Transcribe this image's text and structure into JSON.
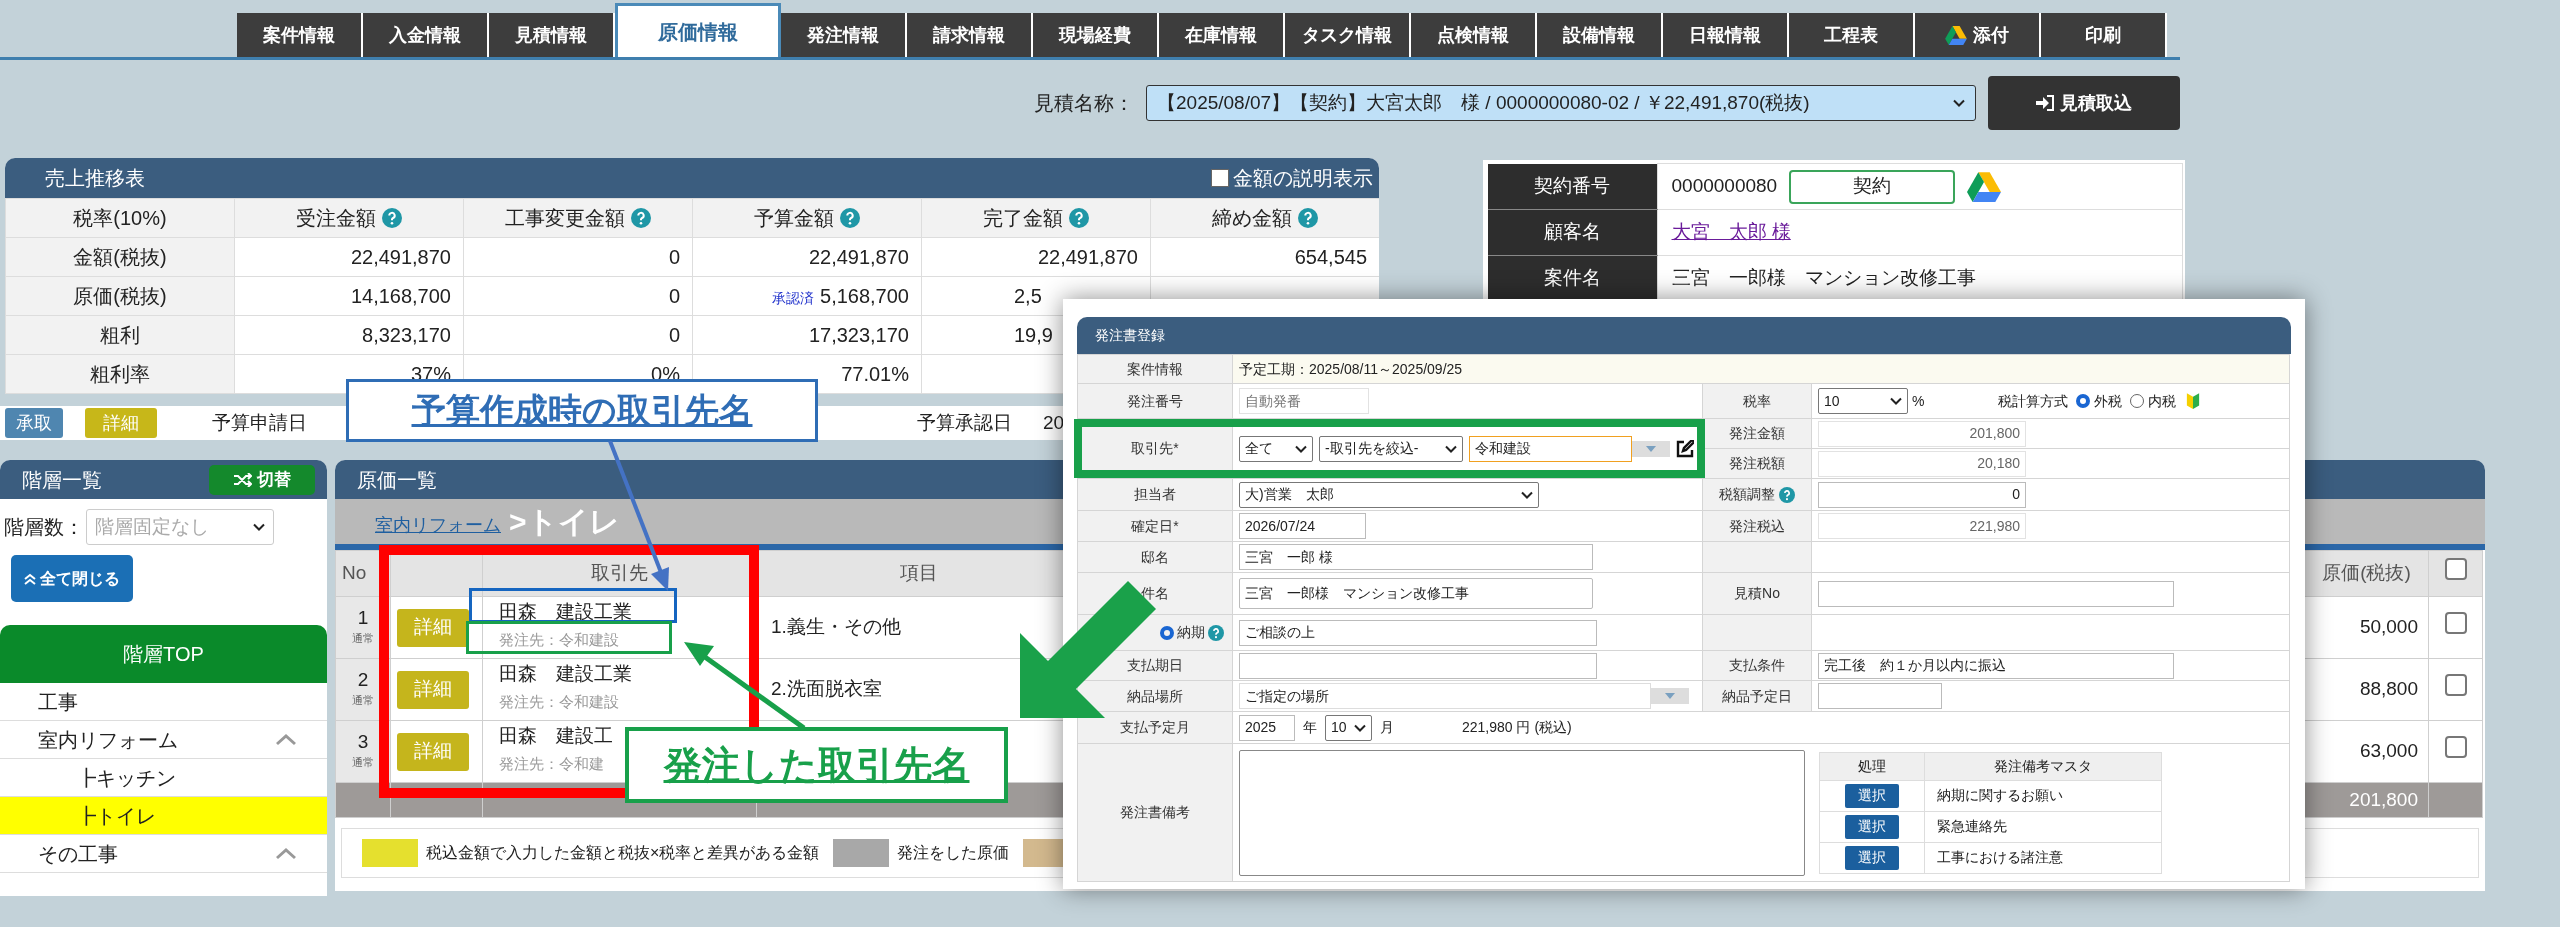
{
  "tabs": [
    {
      "label": "案件情報",
      "kind": "text",
      "selected": false
    },
    {
      "label": "入金情報",
      "kind": "text",
      "selected": false
    },
    {
      "label": "見積情報",
      "kind": "text",
      "selected": false
    },
    {
      "label": "原価情報",
      "kind": "text",
      "selected": true
    },
    {
      "label": "発注情報",
      "kind": "text",
      "selected": false
    },
    {
      "label": "請求情報",
      "kind": "text",
      "selected": false
    },
    {
      "label": "現場経費",
      "kind": "text",
      "selected": false
    },
    {
      "label": "在庫情報",
      "kind": "text",
      "selected": false
    },
    {
      "label": "タスク情報",
      "kind": "text",
      "selected": false
    },
    {
      "label": "点検情報",
      "kind": "text",
      "selected": false
    },
    {
      "label": "設備情報",
      "kind": "text",
      "selected": false
    },
    {
      "label": "日報情報",
      "kind": "text",
      "selected": false
    },
    {
      "label": "工程表",
      "kind": "text",
      "selected": false
    },
    {
      "label": "添付",
      "kind": "drive",
      "selected": false
    },
    {
      "label": "印刷",
      "kind": "text",
      "selected": false
    }
  ],
  "estimate": {
    "label": "見積名称：",
    "value": "【2025/08/07】【契約】大宮太郎　様 / 0000000080-02 / ￥22,491,870(税抜)",
    "button": "見積取込"
  },
  "sales": {
    "title": "売上推移表",
    "toggle": {
      "label": "金額の説明表示",
      "checked": false
    },
    "columns": [
      {
        "label": "税率(10%)"
      },
      {
        "label": "受注金額",
        "help": true
      },
      {
        "label": "工事変更金額",
        "help": true
      },
      {
        "label": "予算金額",
        "help": true
      },
      {
        "label": "完了金額",
        "help": true
      },
      {
        "label": "締め金額",
        "help": true
      }
    ],
    "rows": [
      {
        "cells": [
          "金額(税抜)",
          "22,491,870",
          "0",
          "22,491,870",
          "22,491,870",
          "654,545"
        ]
      },
      {
        "cells": [
          "原価(税抜)",
          "14,168,700",
          "0",
          {
            "badge": "承認済",
            "text": "5,168,700"
          },
          {
            "text": "2,5",
            "cut": true
          }
        ]
      },
      {
        "cells": [
          "粗利",
          "8,323,170",
          "0",
          "17,323,170",
          {
            "text": "19,9",
            "cut": true
          }
        ]
      },
      {
        "cells": [
          "粗利率",
          "37%",
          "0%",
          "77.01%"
        ]
      }
    ]
  },
  "contract": [
    {
      "label": "契約番号",
      "value": "0000000080",
      "kind": "number",
      "button": "契約"
    },
    {
      "label": "顧客名",
      "value": "大宮　太郎 様",
      "kind": "link"
    },
    {
      "label": "案件名",
      "value": "三宮　一郎様　マンション改修工事",
      "kind": "text"
    }
  ],
  "actions": {
    "approve": "承取",
    "detail": "詳細",
    "request_label": "予算申請日",
    "approval_label": "予算承認日",
    "approval_value": "20"
  },
  "hierarchy": {
    "title": "階層一覧",
    "switch": "切替",
    "depth_label": "階層数：",
    "depth_placeholder": "階層固定なし",
    "collapse": "全て閉じる",
    "top": "階層TOP",
    "items": [
      {
        "label": "工事",
        "selected": false
      },
      {
        "label": "室内リフォーム",
        "selected": false,
        "expanded": true,
        "children": [
          {
            "label": "┣キッチン",
            "selected": false
          },
          {
            "label": "┣トイレ",
            "selected": true
          }
        ]
      },
      {
        "label": "その工事",
        "selected": false,
        "expanded": true
      }
    ]
  },
  "costs": {
    "title": "原価一覧",
    "breadcrumb_link": "室内リフォーム",
    "breadcrumb_current": ">トイレ",
    "columns": {
      "no": "No",
      "vendor": "取引先",
      "item": "項目",
      "cost": "原価(税抜)"
    },
    "all_checked": false,
    "rows": [
      {
        "no": "1",
        "type": "通常",
        "button": "詳細",
        "vendor": "田森　建設工業",
        "order": "発注先：令和建設",
        "item": "1.義生・その他",
        "cost": "50,000",
        "checked": false
      },
      {
        "no": "2",
        "type": "通常",
        "button": "詳細",
        "vendor": "田森　建設工業",
        "order": "発注先：令和建設",
        "item": "2.洗面脱衣室",
        "cost": "88,800",
        "checked": false
      },
      {
        "no": "3",
        "type": "通常",
        "button": "詳細",
        "vendor": "田森　建設工",
        "order": "発注先：令和建",
        "cost": "63,000",
        "checked": false
      }
    ],
    "total": "201,800",
    "legend": [
      {
        "color": "#e5e02e",
        "label": "税込金額で入力した金額と税抜×税率と差異がある金額"
      },
      {
        "color": "#a8a8a8",
        "label": "発注をした原価"
      },
      {
        "color": "#d3b98e"
      }
    ]
  },
  "order_form": {
    "title": "発注書登録",
    "project": {
      "label": "案件情報",
      "value": "予定工期：2025/08/11～2025/09/25"
    },
    "order_no": {
      "label": "発注番号",
      "value": "自動発番"
    },
    "tax_rate": {
      "label": "税率",
      "value": "10",
      "unit": "%",
      "method_label": "税計算方式",
      "methods": [
        {
          "label": "外税",
          "selected": true
        },
        {
          "label": "内税",
          "selected": false
        }
      ]
    },
    "vendor": {
      "label": "取引先*",
      "filter": "全て",
      "narrow": "-取引先を絞込-",
      "value": "令和建設"
    },
    "amount": {
      "label": "発注金額",
      "value": "201,800"
    },
    "tax": {
      "label": "発注税額",
      "value": "20,180"
    },
    "staff": {
      "label": "担当者",
      "value": "大)営業　太郎"
    },
    "tax_adjust": {
      "label": "税額調整",
      "value": "0"
    },
    "confirm_date": {
      "label": "確定日*",
      "value": "2026/07/24"
    },
    "total": {
      "label": "発注税込",
      "value": "221,980"
    },
    "house": {
      "label": "邸名",
      "value": "三宮　一郎 様"
    },
    "subject": {
      "label": "件名",
      "value": "三宮　一郎様　マンション改修工事"
    },
    "estimate_no": {
      "label": "見積No"
    },
    "delivery": {
      "label": "納期",
      "selected": true,
      "value": "ご相談の上"
    },
    "pay_date": {
      "label": "支払期日"
    },
    "pay_terms": {
      "label": "支払条件",
      "value": "完工後　約１か月以内に振込"
    },
    "place": {
      "label": "納品場所",
      "value": "ご指定の場所"
    },
    "delivery_date": {
      "label": "納品予定日"
    },
    "pay_month": {
      "label": "支払予定月",
      "year": "2025",
      "year_unit": "年",
      "month": "10",
      "month_unit": "月",
      "amount": "221,980 円 (税込)"
    },
    "notes": {
      "label": "発注書備考",
      "columns": [
        "処理",
        "発注備考マスタ"
      ],
      "rows": [
        {
          "button": "選択",
          "text": "納期に関するお願い"
        },
        {
          "button": "選択",
          "text": "緊急連絡先"
        },
        {
          "button": "選択",
          "text": "工事における諸注意"
        }
      ]
    }
  },
  "annotations": {
    "budget_vendor": "予算作成時の取引先名",
    "ordered_vendor": "発注した取引先名"
  }
}
